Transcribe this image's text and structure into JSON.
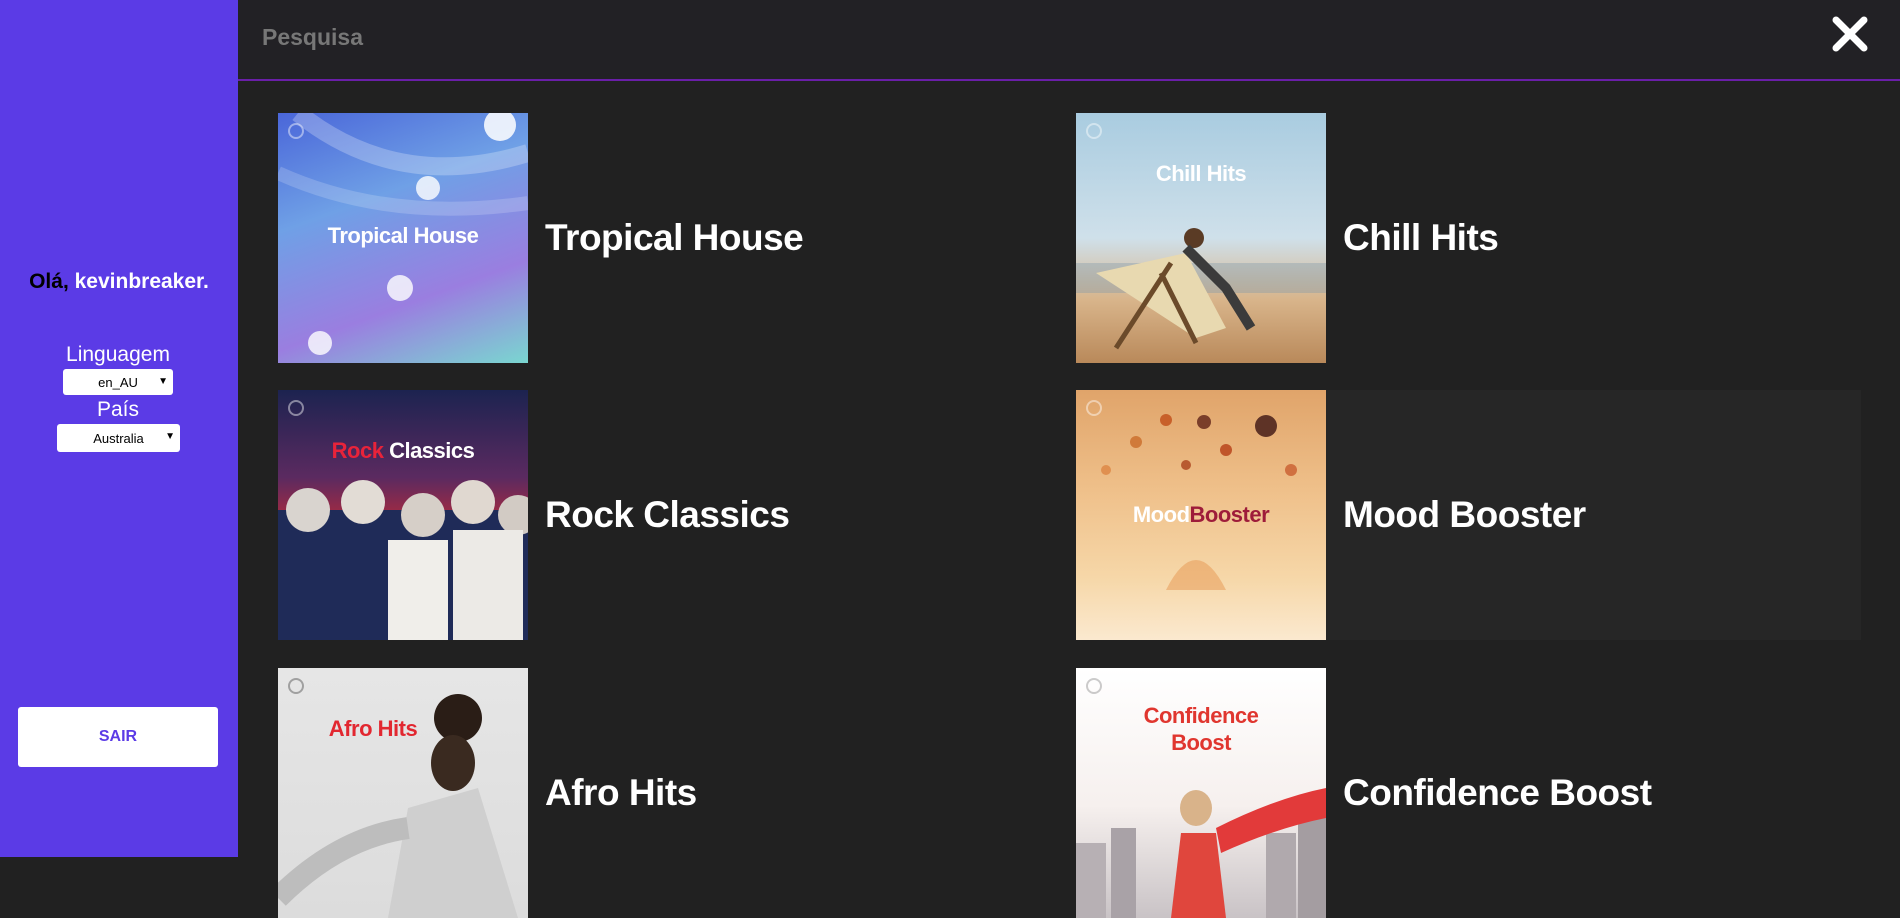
{
  "sidebar": {
    "greeting_hello": "Olá,",
    "username": "kevinbreaker.",
    "language_label": "Linguagem",
    "language_value": "en_AU",
    "country_label": "País",
    "country_value": "Australia",
    "logout_label": "SAIR"
  },
  "header": {
    "search_placeholder": "Pesquisa",
    "close_icon": "close-icon"
  },
  "colors": {
    "sidebar": "#5b3be6",
    "background": "#212121",
    "accent_line": "#6a1fa8"
  },
  "playlists": [
    {
      "cover_title": "Tropical House",
      "name": "Tropical House"
    },
    {
      "cover_title": "Chill Hits",
      "name": "Chill Hits"
    },
    {
      "cover_title_a": "Rock",
      "cover_title_b": "Classics",
      "name": "Rock Classics"
    },
    {
      "cover_title_a": "Mood",
      "cover_title_b": "Booster",
      "name": "Mood Booster"
    },
    {
      "cover_title": "Afro Hits",
      "name": "Afro Hits"
    },
    {
      "cover_title_a": "Confidence",
      "cover_title_b": "Boost",
      "name": "Confidence Boost"
    }
  ]
}
